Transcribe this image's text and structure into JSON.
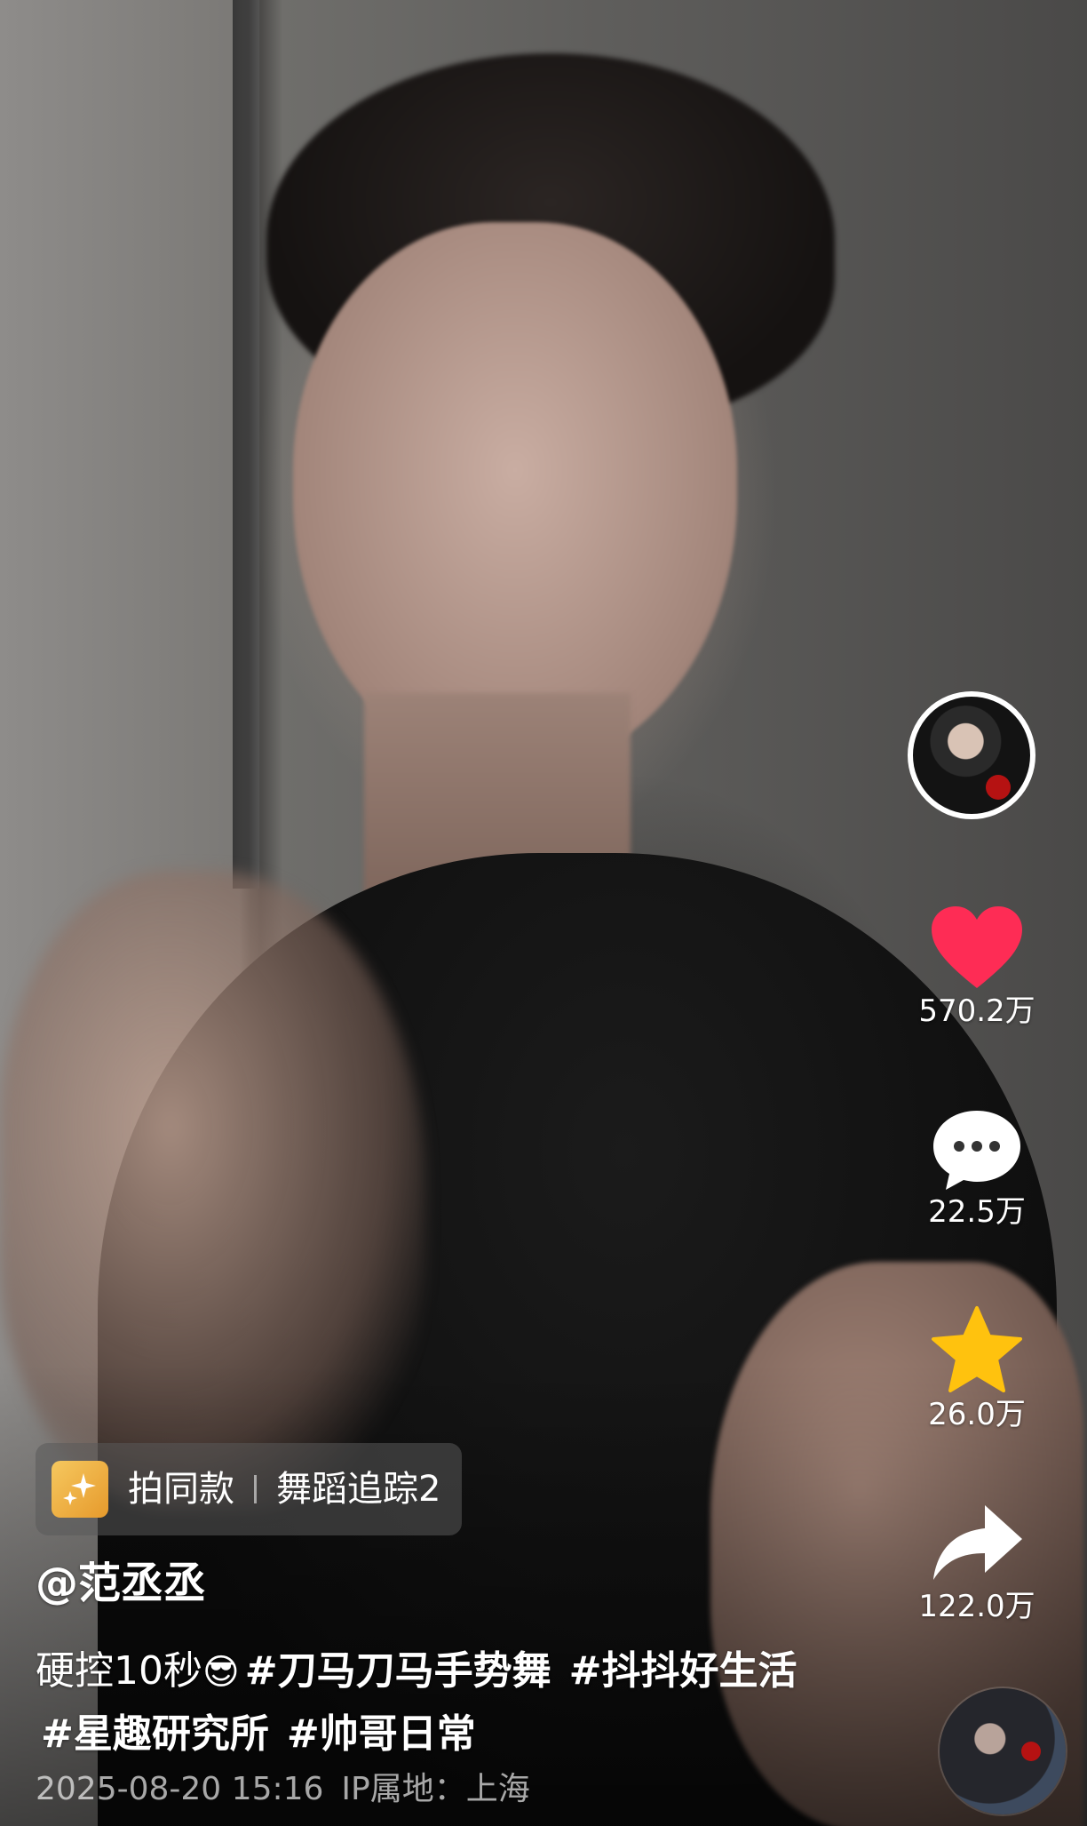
{
  "video": {
    "description_visible": false
  },
  "actions": {
    "like_count": "570.2万",
    "comment_count": "22.5万",
    "favorite_count": "26.0万",
    "share_count": "122.0万",
    "like_color": "#fe2c55",
    "favorite_color": "#ffc20e",
    "icons": {
      "avatar": "creator-avatar",
      "like": "heart-icon",
      "comment": "comment-bubble-icon",
      "favorite": "star-icon",
      "share": "share-arrow-icon",
      "music": "music-disc-icon"
    }
  },
  "template_chip": {
    "icon": "sparkle-icon",
    "action_label": "拍同款",
    "template_name": "舞蹈追踪2"
  },
  "post": {
    "author": "@范丞丞",
    "caption_text": "硬控10秒",
    "caption_emoji": "😎",
    "hashtags": [
      "#刀马刀马手势舞",
      "#抖抖好生活",
      "#星趣研究所",
      "#帅哥日常"
    ],
    "date": "2025-08-20 15:16",
    "ip_location": "IP属地：上海"
  }
}
